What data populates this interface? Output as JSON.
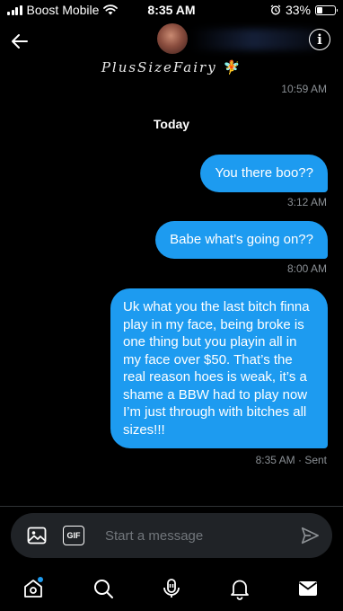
{
  "status_bar": {
    "carrier": "Boost Mobile",
    "time": "8:35 AM",
    "battery": "33%",
    "battery_level": 0.33
  },
  "header": {
    "display_name": "PlusSizeFairy",
    "name_emoji": "🧚",
    "time": "10:59 AM"
  },
  "conversation": {
    "day_label": "Today",
    "messages": [
      {
        "text": "You there boo??",
        "time": "3:12 AM"
      },
      {
        "text": "Babe what’s going on??",
        "time": "8:00 AM"
      },
      {
        "text": "Uk what you the last bitch finna play in my face, being broke is one thing but you playin all in my face over $50. That’s the real reason hoes is weak, it’s a shame a BBW had to play now I’m just through with bitches all sizes!!!",
        "time": "8:35 AM",
        "status": "· Sent"
      }
    ]
  },
  "composer": {
    "gif_label": "GIF",
    "placeholder": "Start a message"
  },
  "colors": {
    "accent": "#1d9bf0",
    "background": "#000000",
    "composer_bg": "#202327",
    "muted_text": "#8a8f94"
  },
  "icons": {
    "back": "arrow-left-icon",
    "info": "info-icon",
    "image": "image-icon",
    "send": "send-icon",
    "tabs": [
      "home-icon",
      "search-icon",
      "spaces-icon",
      "notifications-icon",
      "messages-icon"
    ]
  }
}
